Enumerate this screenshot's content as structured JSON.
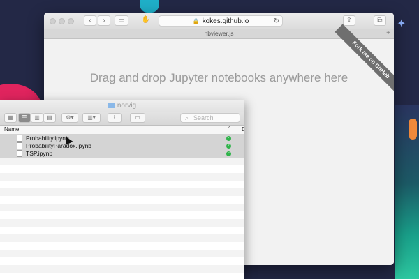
{
  "browser": {
    "url": "kokes.github.io",
    "tab_title": "nbviewer.js",
    "drop_prompt": "Drag and drop Jupyter notebooks anywhere here",
    "ribbon": "Fork me on GitHub"
  },
  "finder": {
    "folder_name": "norvig",
    "search_placeholder": "Search",
    "column_name": "Name",
    "column_d": "D",
    "files": [
      {
        "name": "Probability.ipynb",
        "synced": true
      },
      {
        "name": "ProbabilityParadox.ipynb",
        "synced": true
      },
      {
        "name": "TSP.ipynb",
        "synced": true
      }
    ]
  },
  "icons": [
    "close-icon",
    "minimize-icon",
    "maximize-icon",
    "back-icon",
    "forward-icon",
    "sidebar-icon",
    "lock-icon",
    "reload-icon",
    "share-icon",
    "tabs-icon",
    "plus-icon",
    "folder-icon",
    "file-icon",
    "search-icon",
    "checkmark-icon",
    "star-icon"
  ]
}
